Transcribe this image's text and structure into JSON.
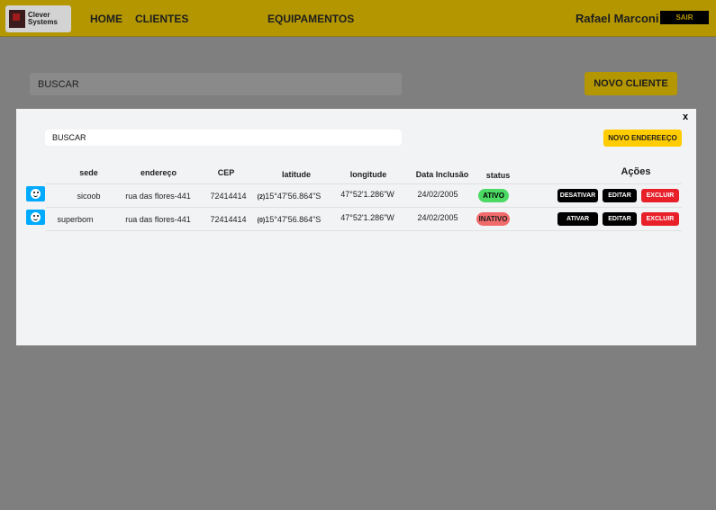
{
  "header": {
    "logo_text_1": "Clever",
    "logo_text_2": "Systems",
    "nav": [
      "HOME",
      "CLIENTES",
      "EQUIPAMENTOS"
    ],
    "user_name": "Rafael Marconi",
    "logout_label": "SAIR"
  },
  "page": {
    "search_value": "BUSCAR",
    "new_client_label": "NOVO CLIENTE"
  },
  "modal": {
    "close_label": "x",
    "search_value": "BUSCAR",
    "new_address_label": "NOVO ENDEREEÇO",
    "columns": [
      "sede",
      "endereço",
      "CEP",
      "latitude",
      "longitude",
      "Data Inclusão",
      "status",
      "Ações"
    ],
    "rows": [
      {
        "sede": "sicoob",
        "endereco": "rua das flores-441",
        "cep": "72414414",
        "index": "(2)",
        "latitude": "15°47'56.864\"S",
        "longitude": "47°52'1.286\"W",
        "data": "24/02/2005",
        "status": "ATIVO",
        "toggle_label": "DESATIVAR",
        "edit_label": "EDITAR",
        "delete_label": "EXCLUIR"
      },
      {
        "sede": "superbom",
        "endereco": "rua das flores-441",
        "cep": "72414414",
        "index": "(0)",
        "latitude": "15°47'56.864\"S",
        "longitude": "47°52'1.286\"W",
        "data": "24/02/2005",
        "status": "INATIVO",
        "toggle_label": "ATIVAR",
        "edit_label": "EDITAR",
        "delete_label": "EXCLUIR"
      }
    ]
  },
  "colors": {
    "brand_yellow": "#ffcc00",
    "active_green": "#4cd964",
    "inactive_red": "#f26b6b",
    "delete_red": "#e8202a"
  }
}
